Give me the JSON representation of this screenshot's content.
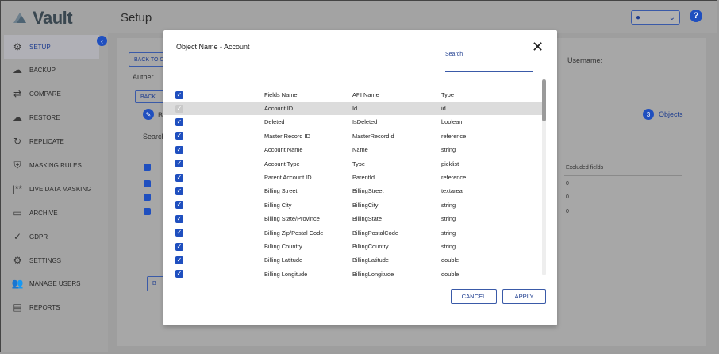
{
  "app": {
    "logo_text": "Vault",
    "page_title": "Setup",
    "help_symbol": "?"
  },
  "sidebar": {
    "items": [
      {
        "label": "SETUP",
        "icon": "gears-icon",
        "glyph": "⚙"
      },
      {
        "label": "BACKUP",
        "icon": "cloud-upload-icon",
        "glyph": "☁"
      },
      {
        "label": "COMPARE",
        "icon": "compare-arrows-icon",
        "glyph": "⇄"
      },
      {
        "label": "RESTORE",
        "icon": "cloud-restore-icon",
        "glyph": "☁"
      },
      {
        "label": "REPLICATE",
        "icon": "replicate-icon",
        "glyph": "↻"
      },
      {
        "label": "MASKING RULES",
        "icon": "mask-shield-icon",
        "glyph": "⛨"
      },
      {
        "label": "LIVE DATA MASKING",
        "icon": "asterisk-mask-icon",
        "glyph": "|**"
      },
      {
        "label": "ARCHIVE",
        "icon": "archive-icon",
        "glyph": "▭"
      },
      {
        "label": "GDPR",
        "icon": "shield-check-icon",
        "glyph": "✓"
      },
      {
        "label": "SETTINGS",
        "icon": "settings-icon",
        "glyph": "⚙"
      },
      {
        "label": "MANAGE USERS",
        "icon": "users-icon",
        "glyph": "👥"
      },
      {
        "label": "REPORTS",
        "icon": "report-icon",
        "glyph": "▤"
      }
    ]
  },
  "background": {
    "back_button_1": "BACK TO C",
    "auth_text": "Auther",
    "back_button_2": "BACK",
    "b_text": "B",
    "search_text": "Search",
    "username_label": "Username:",
    "step_number": "3",
    "step_label": "Objects",
    "excluded_header": "Excluded fields",
    "excluded_values": [
      "0",
      "0",
      "0"
    ],
    "bottom_btn": "B"
  },
  "modal": {
    "title": "Object Name - Account",
    "search_label": "Search",
    "search_value": "",
    "headers": {
      "field": "Fields Name",
      "api": "API Name",
      "type": "Type"
    },
    "rows": [
      {
        "field": "Account ID",
        "api": "Id",
        "type": "id",
        "disabled": true
      },
      {
        "field": "Deleted",
        "api": "IsDeleted",
        "type": "boolean"
      },
      {
        "field": "Master Record ID",
        "api": "MasterRecordId",
        "type": "reference"
      },
      {
        "field": "Account Name",
        "api": "Name",
        "type": "string"
      },
      {
        "field": "Account Type",
        "api": "Type",
        "type": "picklist"
      },
      {
        "field": "Parent Account ID",
        "api": "ParentId",
        "type": "reference"
      },
      {
        "field": "Billing Street",
        "api": "BillingStreet",
        "type": "textarea"
      },
      {
        "field": "Billing City",
        "api": "BillingCity",
        "type": "string"
      },
      {
        "field": "Billing State/Province",
        "api": "BillingState",
        "type": "string"
      },
      {
        "field": "Billing Zip/Postal Code",
        "api": "BillingPostalCode",
        "type": "string"
      },
      {
        "field": "Billing Country",
        "api": "BillingCountry",
        "type": "string"
      },
      {
        "field": "Billing Latitude",
        "api": "BillingLatitude",
        "type": "double"
      },
      {
        "field": "Billing Longitude",
        "api": "BillingLongitude",
        "type": "double"
      }
    ],
    "cancel_label": "CANCEL",
    "apply_label": "APPLY"
  },
  "colors": {
    "accent": "#1f4fbf",
    "overlay": "#9e9e9e",
    "row_highlight": "#dcdcdc"
  }
}
